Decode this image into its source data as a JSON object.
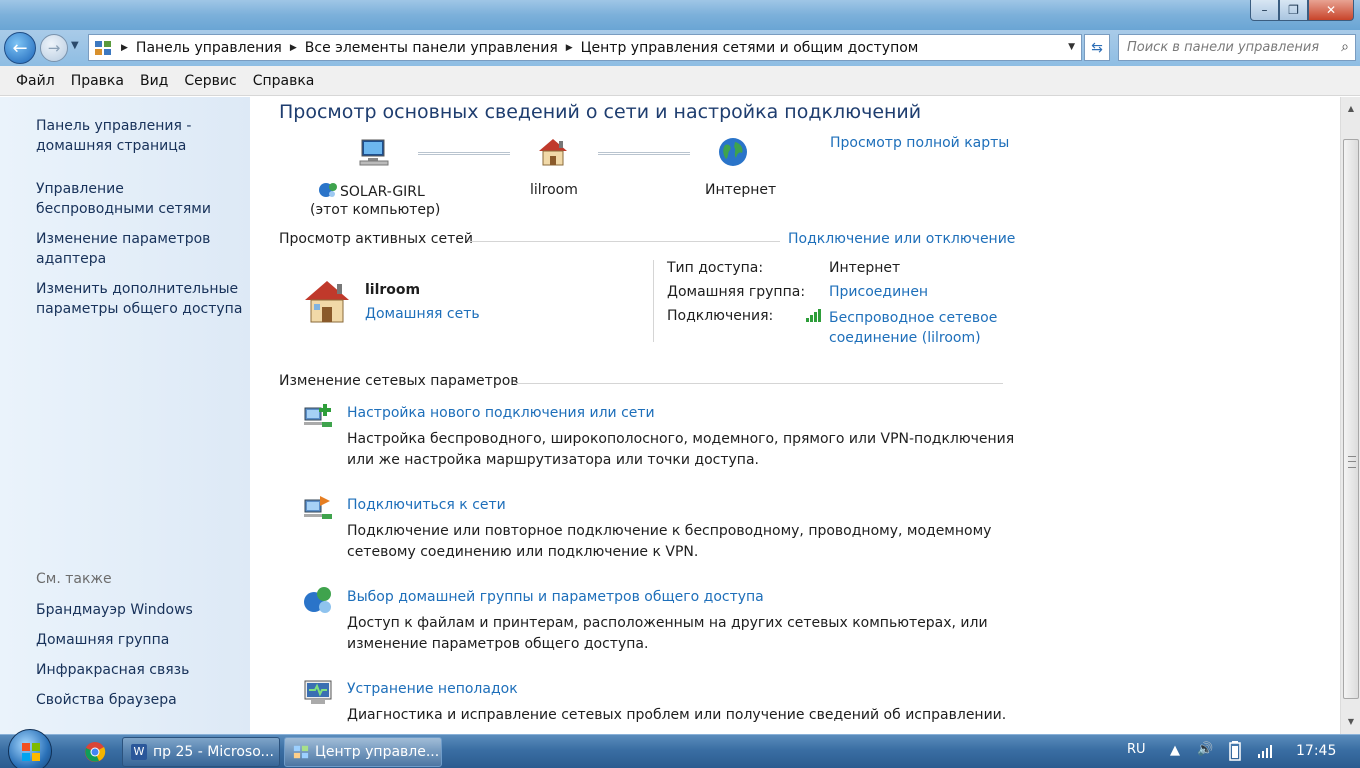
{
  "window": {
    "controls": {
      "minimize": "–",
      "maximize": "❐",
      "close": "✕"
    }
  },
  "address_bar": {
    "breadcrumbs": [
      "Панель управления",
      "Все элементы панели управления",
      "Центр управления сетями и общим доступом"
    ],
    "search_placeholder": "Поиск в панели управления"
  },
  "menu": [
    "Файл",
    "Правка",
    "Вид",
    "Сервис",
    "Справка"
  ],
  "left_pane": {
    "links": [
      "Панель управления - домашняя страница",
      "Управление беспроводными сетями",
      "Изменение параметров адаптера",
      "Изменить дополнительные параметры общего доступа"
    ],
    "see_also_caption": "См. также",
    "see_also": [
      "Брандмауэр Windows",
      "Домашняя группа",
      "Инфракрасная связь",
      "Свойства браузера"
    ]
  },
  "main": {
    "title": "Просмотр основных сведений о сети и настройка подключений",
    "full_map_link": "Просмотр полной карты",
    "map": {
      "computer_name": "SOLAR-GIRL",
      "computer_sub": "(этот компьютер)",
      "network_name": "lilroom",
      "internet": "Интернет"
    },
    "active_networks": {
      "heading": "Просмотр активных сетей",
      "connect_link": "Подключение или отключение",
      "network_name": "lilroom",
      "network_type": "Домашняя сеть",
      "access_type_label": "Тип доступа:",
      "access_type_value": "Интернет",
      "homegroup_label": "Домашняя группа:",
      "homegroup_value": "Присоединен",
      "connections_label": "Подключения:",
      "connection_value_line1": "Беспроводное сетевое",
      "connection_value_line2": "соединение (lilroom)"
    },
    "change_settings": {
      "heading": "Изменение сетевых параметров",
      "items": [
        {
          "title": "Настройка нового подключения или сети",
          "desc1": "Настройка беспроводного, широкополосного, модемного, прямого или VPN-подключения",
          "desc2": "или же настройка маршрутизатора или точки доступа."
        },
        {
          "title": "Подключиться к сети",
          "desc1": "Подключение или повторное подключение к беспроводному, проводному, модемному",
          "desc2": "сетевому соединению или подключение к VPN."
        },
        {
          "title": "Выбор домашней группы и параметров общего доступа",
          "desc1": "Доступ к файлам и принтерам, расположенным на других сетевых компьютерах, или",
          "desc2": "изменение параметров общего доступа."
        },
        {
          "title": "Устранение неполадок",
          "desc1": "Диагностика и исправление сетевых проблем или получение сведений об исправлении."
        }
      ]
    }
  },
  "taskbar": {
    "tasks": [
      "пр 25 - Microso...",
      "Центр управле..."
    ],
    "language": "RU",
    "clock": "17:45"
  }
}
